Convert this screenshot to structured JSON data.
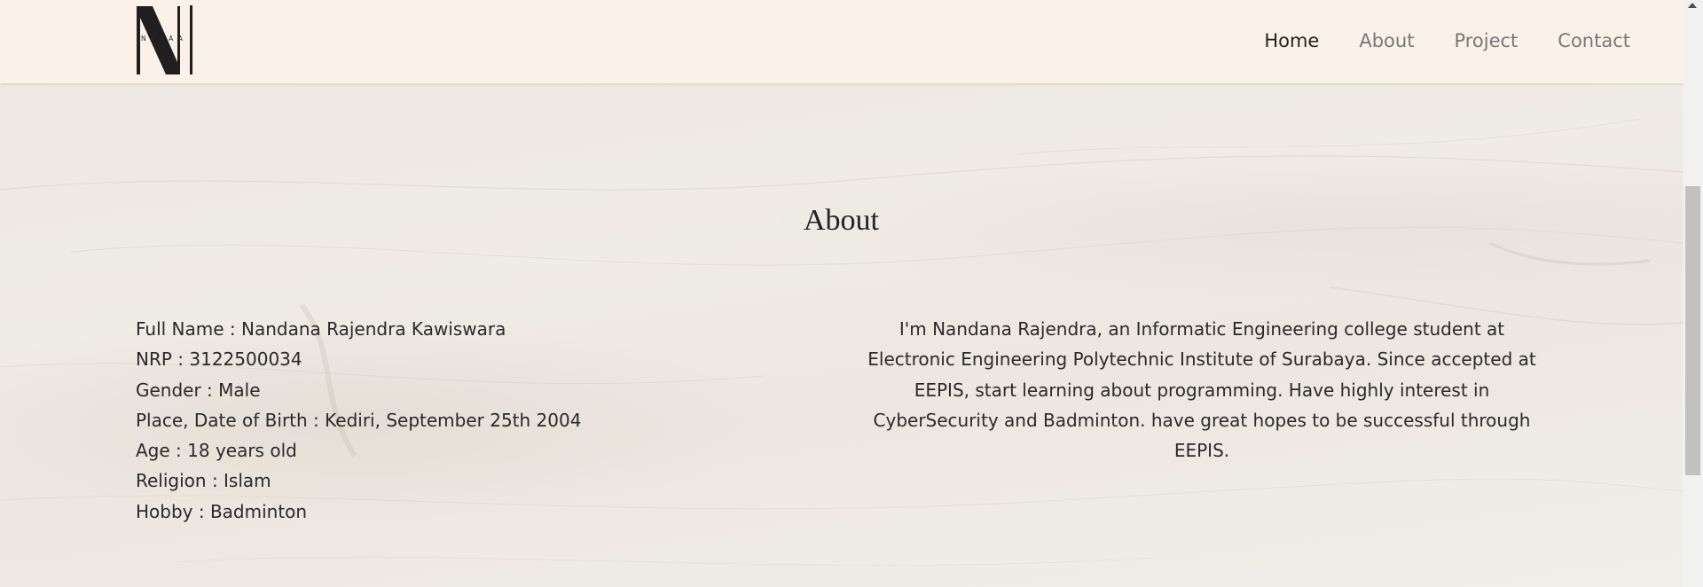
{
  "brand": {
    "logo_letter": "N",
    "logo_word": "NARAA",
    "logo_color": "#1f1f1f"
  },
  "nav": {
    "items": [
      {
        "label": "Home",
        "active": true
      },
      {
        "label": "About",
        "active": false
      },
      {
        "label": "Project",
        "active": false
      },
      {
        "label": "Contact",
        "active": false
      }
    ]
  },
  "about": {
    "title": "About",
    "details": [
      "Full Name : Nandana Rajendra Kawiswara",
      "NRP : 3122500034",
      "Gender : Male",
      "Place, Date of Birth : Kediri, September 25th 2004",
      "Age : 18 years old",
      "Religion : Islam",
      "Hobby : Badminton"
    ],
    "bio": "I'm Nandana Rajendra, an Informatic Engineering college student at Electronic Engineering Polytechnic Institute of Surabaya. Since accepted at EEPIS, start learning about programming. Have highly interest in CyberSecurity and Badminton. have great hopes to be successful through EEPIS."
  },
  "colors": {
    "navbar_bg": "#fcf1e8",
    "section_bg": "#ede8e1",
    "text": "#2a2a2a",
    "nav_inactive": "#777777",
    "nav_active": "#222222"
  }
}
